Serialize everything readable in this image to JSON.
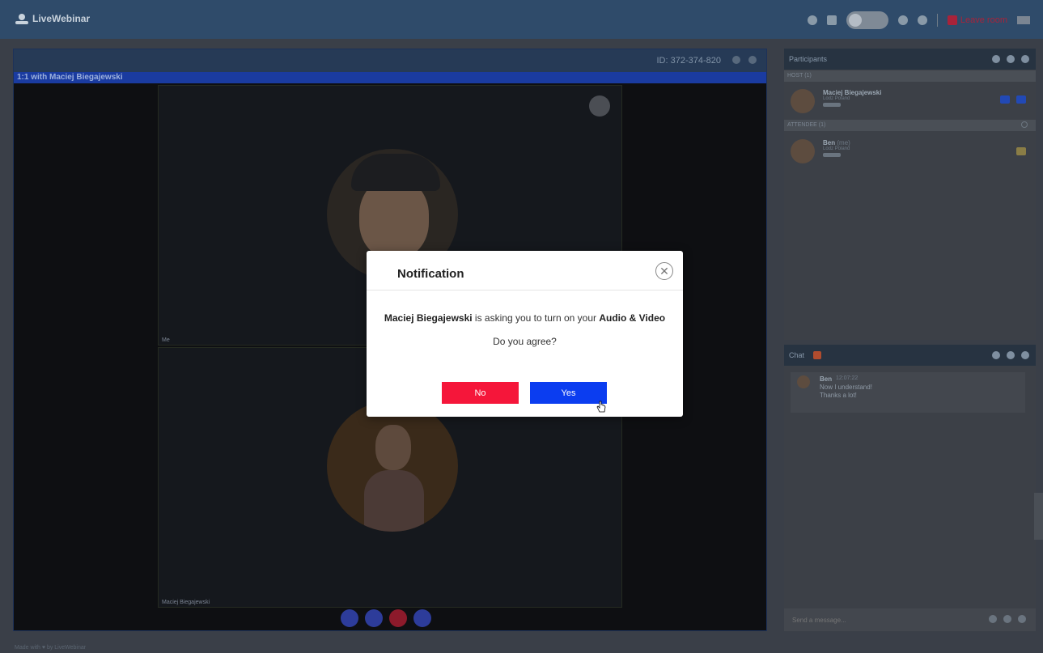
{
  "app": {
    "name": "LiveWebinar"
  },
  "topbar": {
    "leave_label": "Leave room"
  },
  "stage": {
    "room_id": "ID: 372-374-820",
    "room_title": "1:1 with Maciej Biegajewski",
    "video_self_label": "Me",
    "video_host_label": "Maciej Biegajewski"
  },
  "participants": {
    "title": "Participants",
    "host_section": "HOST (1)",
    "attendee_section": "ATTENDEE (1)",
    "host": {
      "name": "Maciej Biegajewski",
      "location": "Lodz Poland"
    },
    "attendee": {
      "name": "Ben",
      "tag": "(me)",
      "location": "Lodz Poland"
    }
  },
  "chat": {
    "title": "Chat",
    "message": {
      "author": "Ben",
      "time": "12:07:22",
      "line1": "Now I understand!",
      "line2": "Thanks a lot!"
    },
    "input_placeholder": "Send a message..."
  },
  "footer": {
    "text": "Made with ♥ by LiveWebinar"
  },
  "modal": {
    "title": "Notification",
    "requester": "Maciej Biegajewski",
    "message_middle": " is asking you to turn on your ",
    "request_items": "Audio & Video",
    "question": "Do you agree?",
    "no_label": "No",
    "yes_label": "Yes"
  },
  "colors": {
    "no_button": "#f5163a",
    "yes_button": "#0b3df0",
    "topbar": "#2f4b6a"
  },
  "icons": [
    "logo-icon",
    "close-icon",
    "gear-icon",
    "mic-icon",
    "camera-icon",
    "hangup-icon",
    "settings-icon",
    "pointer-cursor-icon"
  ]
}
